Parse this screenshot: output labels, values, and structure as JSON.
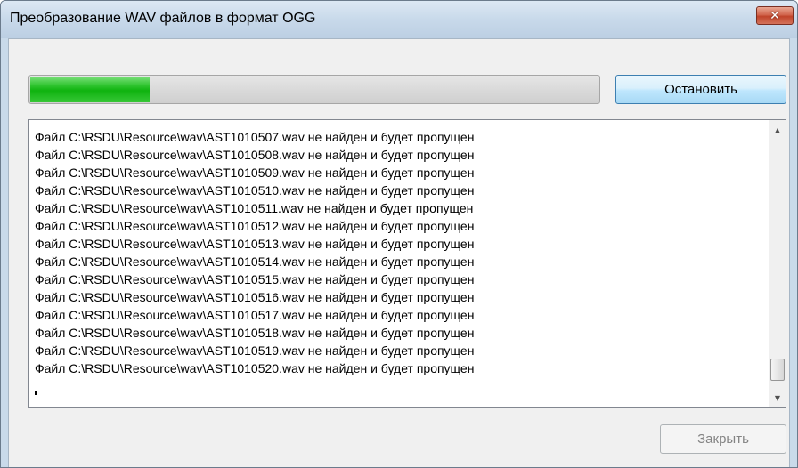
{
  "window": {
    "title": "Преобразование WAV файлов в формат OGG",
    "close_symbol": "✕"
  },
  "progress": {
    "fraction": 0.21,
    "fill_color": "#0fb30f"
  },
  "buttons": {
    "stop_label": "Остановить",
    "close_label": "Закрыть",
    "close_enabled": false
  },
  "log": {
    "lines": [
      "Файл C:\\RSDU\\Resource\\wav\\AST1010507.wav не найден и будет пропущен",
      "Файл C:\\RSDU\\Resource\\wav\\AST1010508.wav не найден и будет пропущен",
      "Файл C:\\RSDU\\Resource\\wav\\AST1010509.wav не найден и будет пропущен",
      "Файл C:\\RSDU\\Resource\\wav\\AST1010510.wav не найден и будет пропущен",
      "Файл C:\\RSDU\\Resource\\wav\\AST1010511.wav не найден и будет пропущен",
      "Файл C:\\RSDU\\Resource\\wav\\AST1010512.wav не найден и будет пропущен",
      "Файл C:\\RSDU\\Resource\\wav\\AST1010513.wav не найден и будет пропущен",
      "Файл C:\\RSDU\\Resource\\wav\\AST1010514.wav не найден и будет пропущен",
      "Файл C:\\RSDU\\Resource\\wav\\AST1010515.wav не найден и будет пропущен",
      "Файл C:\\RSDU\\Resource\\wav\\AST1010516.wav не найден и будет пропущен",
      "Файл C:\\RSDU\\Resource\\wav\\AST1010517.wav не найден и будет пропущен",
      "Файл C:\\RSDU\\Resource\\wav\\AST1010518.wav не найден и будет пропущен",
      "Файл C:\\RSDU\\Resource\\wav\\AST1010519.wav не найден и будет пропущен",
      "Файл C:\\RSDU\\Resource\\wav\\AST1010520.wav не найден и будет пропущен"
    ]
  },
  "icons": {
    "close": "close-icon",
    "scroll_up": "arrow-up-icon",
    "scroll_down": "arrow-down-icon"
  }
}
